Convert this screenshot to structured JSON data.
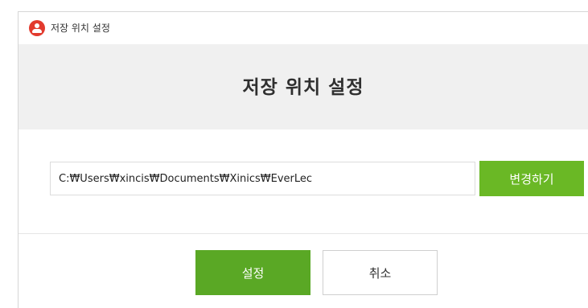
{
  "window": {
    "title": "저장 위치 설정",
    "icon": "app-person-icon"
  },
  "header": {
    "title": "저장 위치 설정"
  },
  "path_field": {
    "value": "C:₩Users₩xincis₩Documents₩Xinics₩EverLec"
  },
  "buttons": {
    "change_label": "변경하기",
    "confirm_label": "설정",
    "cancel_label": "취소"
  },
  "colors": {
    "accent_green": "#6ab825",
    "confirm_green": "#5aa825",
    "app_icon_red": "#e23a2e",
    "header_background": "#f0f0f0"
  }
}
